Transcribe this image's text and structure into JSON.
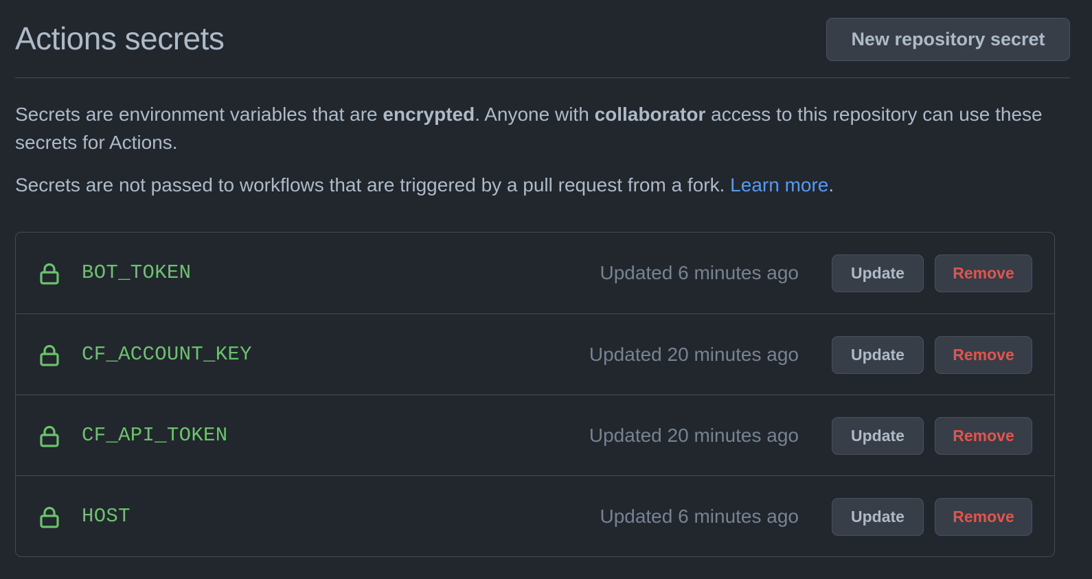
{
  "header": {
    "title": "Actions secrets",
    "new_secret_label": "New repository secret"
  },
  "description": {
    "part1": "Secrets are environment variables that are ",
    "bold1": "encrypted",
    "part2": ". Anyone with ",
    "bold2": "collaborator",
    "part3": " access to this repository can use these secrets for Actions."
  },
  "note": {
    "text": "Secrets are not passed to workflows that are triggered by a pull request from a fork. ",
    "link_label": "Learn more",
    "suffix": "."
  },
  "secrets": [
    {
      "name": "BOT_TOKEN",
      "updated": "Updated 6 minutes ago",
      "update_label": "Update",
      "remove_label": "Remove"
    },
    {
      "name": "CF_ACCOUNT_KEY",
      "updated": "Updated 20 minutes ago",
      "update_label": "Update",
      "remove_label": "Remove"
    },
    {
      "name": "CF_API_TOKEN",
      "updated": "Updated 20 minutes ago",
      "update_label": "Update",
      "remove_label": "Remove"
    },
    {
      "name": "HOST",
      "updated": "Updated 6 minutes ago",
      "update_label": "Update",
      "remove_label": "Remove"
    }
  ],
  "icons": {
    "secret": "lock-icon"
  },
  "colors": {
    "background": "#22272e",
    "secret_name": "#6bc46d",
    "link": "#539bf5",
    "danger": "#e5534b"
  }
}
